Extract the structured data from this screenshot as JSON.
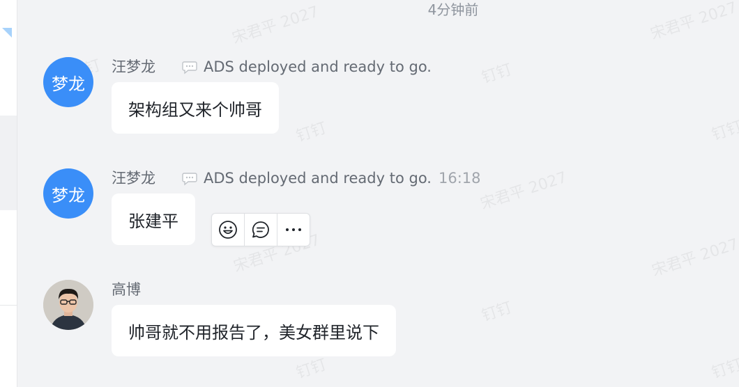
{
  "time_divider": "4分钟前",
  "watermark_text": "宋君平 2027",
  "watermark_text_2": "钉钉",
  "messages": [
    {
      "avatar_text": "梦龙",
      "sender": "汪梦龙",
      "status": "ADS deployed and ready to go.",
      "time": "",
      "text": "架构组又来个帅哥"
    },
    {
      "avatar_text": "梦龙",
      "sender": "汪梦龙",
      "status": "ADS deployed and ready to go.",
      "time": "16:18",
      "text": "张建平"
    },
    {
      "avatar_text": "",
      "sender": "高博",
      "status": "",
      "time": "",
      "text": "帅哥就不用报告了，美女群里说下"
    }
  ],
  "toolbar": {
    "icons": [
      "emoji-icon",
      "reply-icon",
      "more-icon"
    ]
  },
  "colors": {
    "background": "#f2f3f5",
    "avatar_blue": "#3a8ef8",
    "bubble": "#ffffff",
    "secondary_text": "#646a73"
  }
}
